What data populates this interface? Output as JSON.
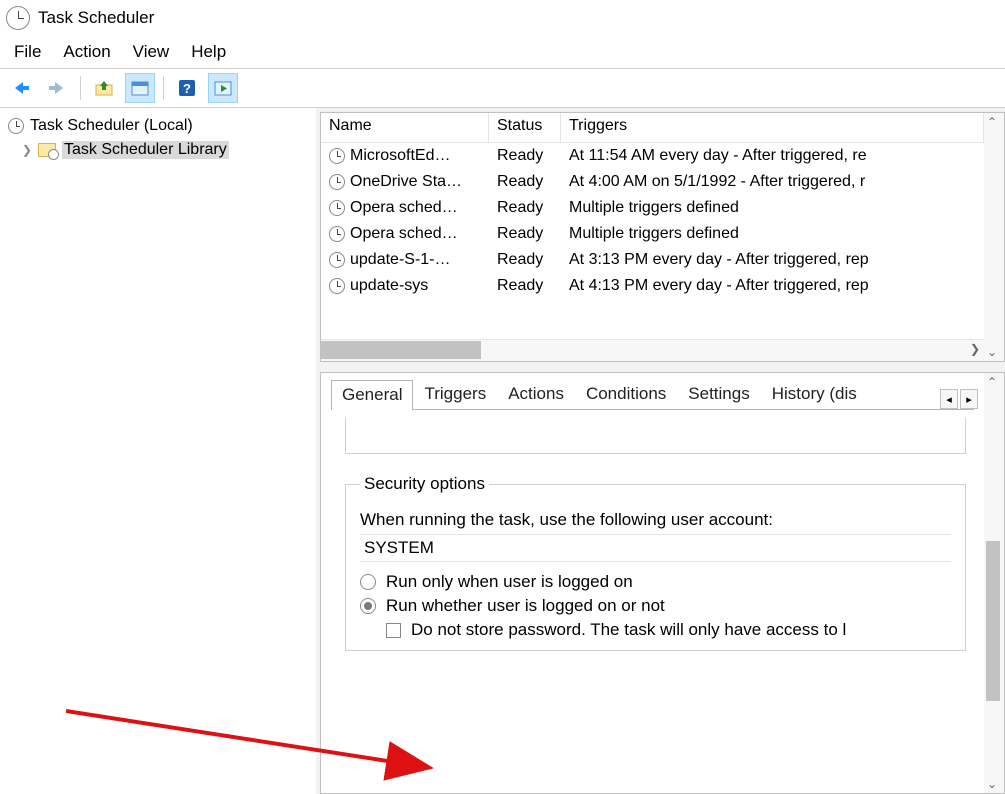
{
  "window": {
    "title": "Task Scheduler"
  },
  "menu": {
    "file": "File",
    "action": "Action",
    "view": "View",
    "help": "Help"
  },
  "tree": {
    "root": "Task Scheduler (Local)",
    "library": "Task Scheduler Library"
  },
  "list": {
    "columns": {
      "name": "Name",
      "status": "Status",
      "triggers": "Triggers"
    },
    "rows": [
      {
        "name": "MicrosoftEd…",
        "status": "Ready",
        "triggers": "At 11:54 AM every day - After triggered, re"
      },
      {
        "name": "OneDrive Sta…",
        "status": "Ready",
        "triggers": "At 4:00 AM on 5/1/1992 - After triggered, r"
      },
      {
        "name": "Opera sched…",
        "status": "Ready",
        "triggers": "Multiple triggers defined"
      },
      {
        "name": "Opera sched…",
        "status": "Ready",
        "triggers": "Multiple triggers defined"
      },
      {
        "name": "update-S-1-…",
        "status": "Ready",
        "triggers": "At 3:13 PM every day - After triggered, rep"
      },
      {
        "name": "update-sys",
        "status": "Ready",
        "triggers": "At 4:13 PM every day - After triggered, rep"
      }
    ]
  },
  "tabs": {
    "general": "General",
    "triggers": "Triggers",
    "actions": "Actions",
    "conditions": "Conditions",
    "settings": "Settings",
    "history": "History (dis"
  },
  "security": {
    "legend": "Security options",
    "when_running": "When running the task, use the following user account:",
    "account": "SYSTEM",
    "run_logged_on": "Run only when user is logged on",
    "run_whether": "Run whether user is logged on or not",
    "do_not_store": "Do not store password.  The task will only have access to l"
  }
}
